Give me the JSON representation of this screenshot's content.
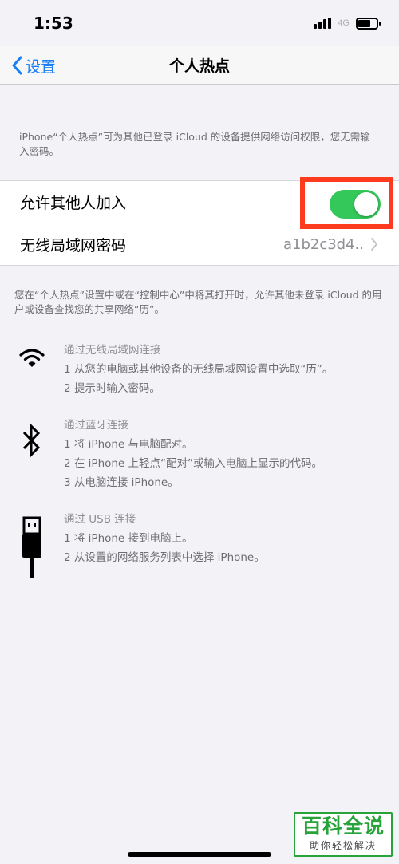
{
  "status_bar": {
    "time": "1:53",
    "network": "4G",
    "battery_level": 0.7
  },
  "nav": {
    "back_label": "设置",
    "title": "个人热点"
  },
  "hotspot_description": "iPhone“个人热点”可为其他已登录 iCloud 的设备提供网络访问权限，您无需输入密码。",
  "settings": {
    "allow_others": {
      "label": "允许其他人加入",
      "enabled": true
    },
    "wifi_password": {
      "label": "无线局域网密码",
      "value": "a1b2c3d4.."
    }
  },
  "info_text": "您在“个人热点”设置中或在“控制中心”中将其打开时，允许其他未登录 iCloud 的用户或设备查找您的共享网络“历”。",
  "methods": [
    {
      "icon": "wifi-icon",
      "title": "通过无线局域网连接",
      "steps": [
        "1 从您的电脑或其他设备的无线局域网设置中选取“历”。",
        "2 提示时输入密码。"
      ]
    },
    {
      "icon": "bluetooth-icon",
      "title": "通过蓝牙连接",
      "steps": [
        "1 将 iPhone 与电脑配对。",
        "2 在 iPhone 上轻点“配对”或输入电脑上显示的代码。",
        "3 从电脑连接 iPhone。"
      ]
    },
    {
      "icon": "usb-cable-icon",
      "title": "通过 USB 连接",
      "steps": [
        "1 将 iPhone 接到电脑上。",
        "2 从设置的网络服务列表中选择 iPhone。"
      ]
    }
  ],
  "watermark": {
    "brand": "百科全说",
    "tagline": "助你轻松解决"
  },
  "colors": {
    "accent": "#1a7ff2",
    "toggle_on": "#34c759",
    "highlight": "#ff3b1f",
    "watermark": "#27a33a"
  }
}
